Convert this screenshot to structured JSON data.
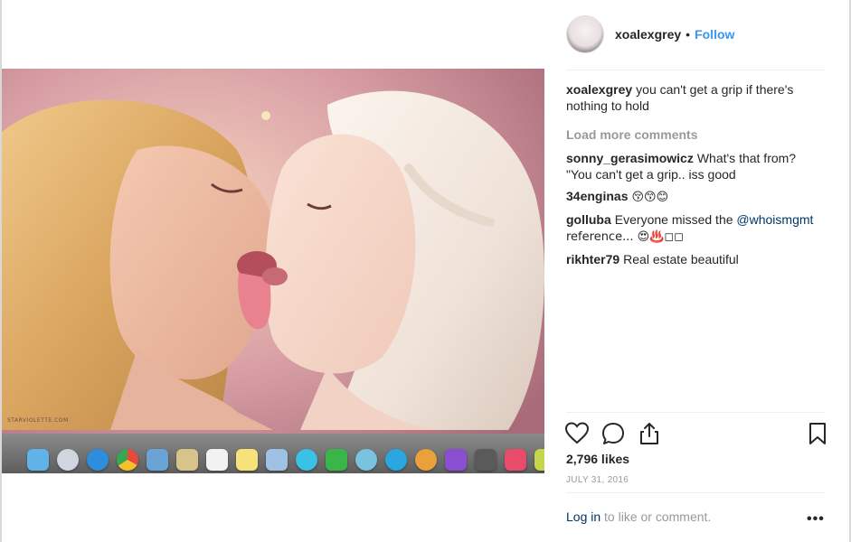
{
  "post": {
    "username": "xoalexgrey",
    "separator": "•",
    "follow_label": "Follow",
    "media_watermark": "STARVIOLETTE.COM",
    "caption": {
      "user": "xoalexgrey",
      "text": "you can't get a grip if there's nothing to hold"
    },
    "load_more_label": "Load more comments",
    "comments": [
      {
        "user": "sonny_gerasimowicz",
        "text": "What's that from? \"You can't get a grip.. iss good"
      },
      {
        "user": "34enginas",
        "text": "😚😙😊"
      },
      {
        "user": "golluba",
        "text_before": "Everyone missed the",
        "mention": "@whoismgmt",
        "text_after": "reference... 😍♨️◻◻"
      },
      {
        "user": "rikhter79",
        "text": "Real estate beautiful"
      }
    ],
    "likes": "2,796 likes",
    "date": "JULY 31, 2016",
    "login_link": "Log in",
    "login_text": "to like or comment.",
    "more_label": "•••"
  },
  "icons": {
    "like": "heart-icon",
    "comment": "comment-icon",
    "share": "share-icon",
    "save": "bookmark-icon",
    "more": "more-options-icon"
  },
  "colors": {
    "link_blue": "#3897f0",
    "mention_blue": "#003569",
    "muted_gray": "#999999",
    "text": "#262626"
  }
}
